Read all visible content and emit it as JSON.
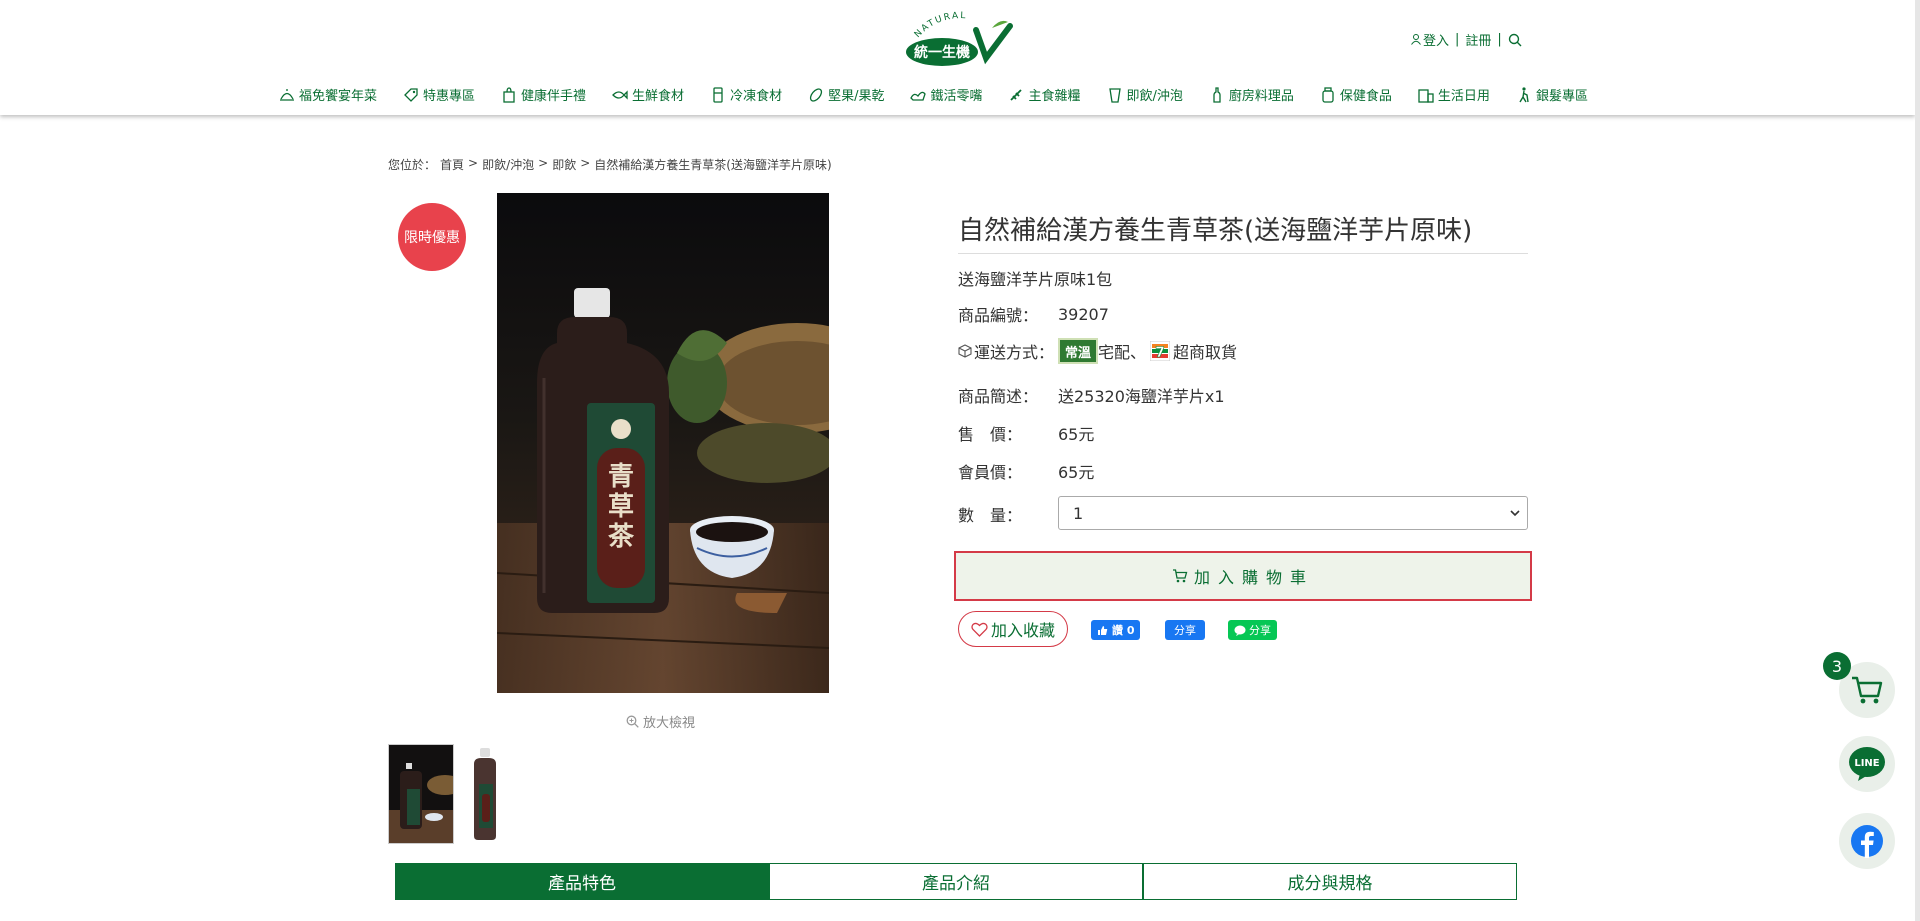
{
  "header": {
    "logo_text": "統一生機",
    "logo_arc_text": "NATURAL",
    "login": "登入",
    "register": "註冊",
    "separator": "|"
  },
  "nav": {
    "items": [
      {
        "label": "福免饗宴年菜",
        "icon": "dish-cover-icon"
      },
      {
        "label": "特惠專區",
        "icon": "tag-icon"
      },
      {
        "label": "健康伴手禮",
        "icon": "gift-bag-icon"
      },
      {
        "label": "生鮮食材",
        "icon": "fish-icon"
      },
      {
        "label": "冷凍食材",
        "icon": "freezer-icon"
      },
      {
        "label": "堅果/果乾",
        "icon": "nut-icon"
      },
      {
        "label": "鐵活零嘴",
        "icon": "snack-icon"
      },
      {
        "label": "主食雜糧",
        "icon": "grain-icon"
      },
      {
        "label": "即飲/沖泡",
        "icon": "cup-icon"
      },
      {
        "label": "廚房料理品",
        "icon": "bottle-icon"
      },
      {
        "label": "保健食品",
        "icon": "supplement-icon"
      },
      {
        "label": "生活日用",
        "icon": "household-icon"
      },
      {
        "label": "銀髮專區",
        "icon": "elder-walking-icon"
      }
    ]
  },
  "breadcrumb": {
    "prefix": "您位於：",
    "items": [
      "首頁",
      "即飲/沖泡",
      "即飲",
      "自然補給漢方養生青草茶(送海鹽洋芋片原味)"
    ],
    "separator": ">"
  },
  "product": {
    "badge": "限時優惠",
    "title": "自然補給漢方養生青草茶(送海鹽洋芋片原味)",
    "subtitle": "送海鹽洋芋片原味1包",
    "sku_label": "商品編號：",
    "sku": "39207",
    "shipping_label": "運送方式：",
    "shipping_badge": "常溫",
    "shipping_home": "宅配、",
    "shipping_store": "超商取貨",
    "desc_label": "商品簡述：",
    "desc": "送25320海鹽洋芋片x1",
    "price_label": "售　價：",
    "price": "65元",
    "member_price_label": "會員價：",
    "member_price": "65元",
    "qty_label": "數　量：",
    "qty_value": "1",
    "add_to_cart": "加入購物車",
    "favorite": "加入收藏",
    "zoom": "放大檢視",
    "bottle_text": "青草茶"
  },
  "social": {
    "fb_like": "讚 0",
    "fb_share": "分享",
    "line_share": "分享"
  },
  "tabs": [
    {
      "label": "產品特色",
      "active": true
    },
    {
      "label": "產品介紹",
      "active": false
    },
    {
      "label": "成分與規格",
      "active": false
    }
  ],
  "floating": {
    "cart_count": "3",
    "line_label": "LINE"
  },
  "colors": {
    "brand_green": "#0a6e33",
    "badge_red": "#e8424c",
    "cart_border": "#d43a47",
    "facebook_blue": "#1877f2",
    "line_green": "#06c755"
  }
}
